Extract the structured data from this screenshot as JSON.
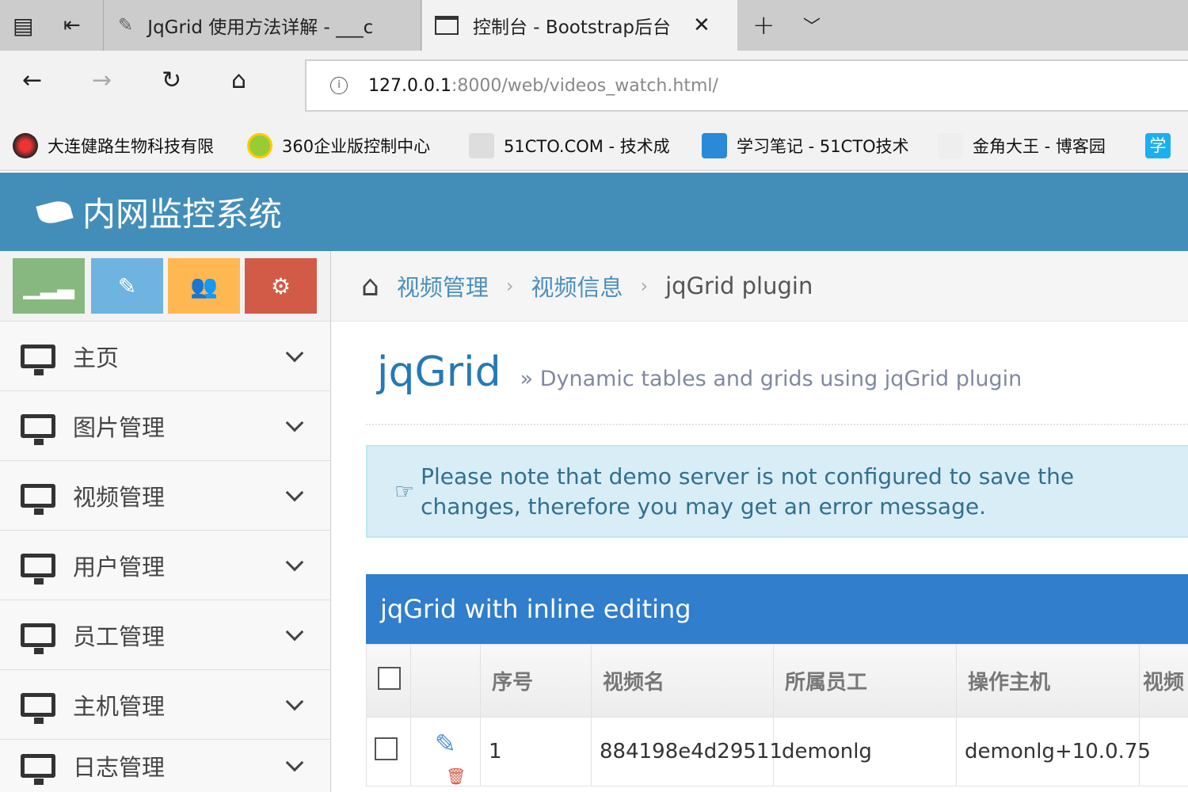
{
  "browser": {
    "tabs": [
      {
        "title": "JqGrid 使用方法详解 - ___c"
      },
      {
        "title": "控制台 - Bootstrap后台",
        "active": true
      }
    ],
    "url_host": "127.0.0.1",
    "url_rest": ":8000/web/videos_watch.html/",
    "bookmarks": [
      "大连健路生物科技有限",
      "360企业版控制中心",
      "51CTO.COM - 技术成",
      "学习笔记 - 51CTO技术",
      "金角大王 - 博客园",
      "学"
    ]
  },
  "app": {
    "title": "内网监控系统",
    "accent": "#438eb9"
  },
  "sidebar": {
    "shortcuts": [
      {
        "icon": "signal-icon",
        "color": "#87b87f"
      },
      {
        "icon": "pencil-icon",
        "color": "#6fb3e0"
      },
      {
        "icon": "users-icon",
        "color": "#ffb752"
      },
      {
        "icon": "cogs-icon",
        "color": "#d15b47"
      }
    ],
    "items": [
      "主页",
      "图片管理",
      "视频管理",
      "用户管理",
      "员工管理",
      "主机管理",
      "日志管理"
    ]
  },
  "breadcrumb": [
    "视频管理",
    "视频信息",
    "jqGrid plugin"
  ],
  "page": {
    "title": "jqGrid",
    "subtitle": "» Dynamic tables and grids using jqGrid plugin"
  },
  "alert": "Please note that demo server is not configured to save the changes, therefore you may get an error message.",
  "grid": {
    "caption": "jqGrid with inline editing",
    "columns": [
      "序号",
      "视频名",
      "所属员工",
      "操作主机",
      "视频"
    ],
    "rows": [
      [
        "1",
        "884198e4d29511",
        "demonlg",
        "demonlg+10.0.75",
        ""
      ]
    ]
  }
}
